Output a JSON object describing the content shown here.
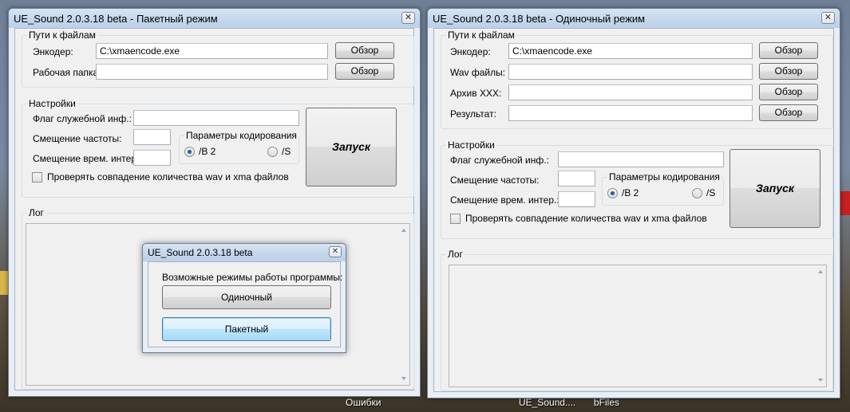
{
  "desktop": {
    "labels": [
      "Ошибки",
      "UE_Sound....",
      "bFiles"
    ]
  },
  "window_batch": {
    "title": "UE_Sound 2.0.3.18 beta - Пакетный режим",
    "paths_group": "Пути к файлам",
    "encoder_label": "Энкодер:",
    "encoder_value": "C:\\xmaencode.exe",
    "workdir_label": "Рабочая папка:",
    "workdir_value": "",
    "browse_label": "Обзор",
    "settings_group": "Настройки",
    "flag_label": "Флаг служебной инф.:",
    "freq_label": "Смещение частоты:",
    "time_label": "Смещение врем. интер.:",
    "encoding_group": "Параметры кодирования",
    "radio_b2": "/B 2",
    "radio_s": "/S",
    "start_label": "Запуск",
    "check_label": "Проверять совпадение количества wav и xma файлов",
    "log_group": "Лог"
  },
  "window_single": {
    "title": "UE_Sound 2.0.3.18 beta - Одиночный режим",
    "paths_group": "Пути к файлам",
    "encoder_label": "Энкодер:",
    "encoder_value": "C:\\xmaencode.exe",
    "wav_label": "Wav файлы:",
    "archive_label": "Архив XXX:",
    "result_label": "Результат:",
    "browse_label": "Обзор",
    "settings_group": "Настройки",
    "flag_label": "Флаг служебной инф.:",
    "freq_label": "Смещение частоты:",
    "time_label": "Смещение врем. интер.:",
    "encoding_group": "Параметры кодирования",
    "radio_b2": "/B 2",
    "radio_s": "/S",
    "start_label": "Запуск",
    "check_label": "Проверять совпадение количества wav и xma файлов",
    "log_group": "Лог"
  },
  "dialog": {
    "title": "UE_Sound 2.0.3.18 beta",
    "prompt": "Возможные режимы работы программы:",
    "single_button": "Одиночный",
    "batch_button": "Пакетный"
  },
  "colors": {
    "title_gradient_top": "#d7e4f3",
    "window_face": "#f0f0f0",
    "focus_border": "#3c7fb1"
  }
}
